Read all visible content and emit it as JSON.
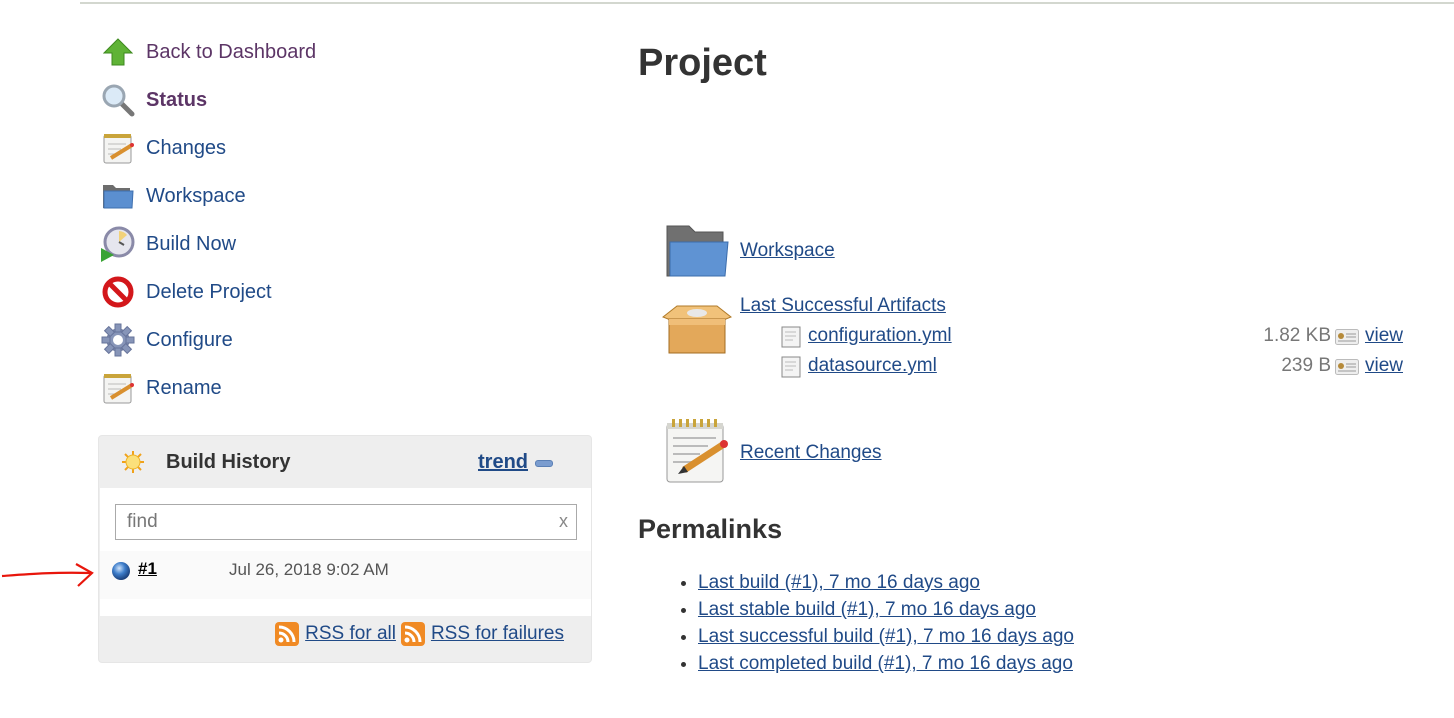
{
  "sidebar": {
    "tasks": [
      {
        "label": "Back to Dashboard",
        "icon": "up-arrow-icon",
        "state": "visited"
      },
      {
        "label": "Status",
        "icon": "magnifier-icon",
        "state": "active"
      },
      {
        "label": "Changes",
        "icon": "notepad-icon",
        "state": "normal"
      },
      {
        "label": "Workspace",
        "icon": "folder-icon",
        "state": "normal"
      },
      {
        "label": "Build Now",
        "icon": "clock-play-icon",
        "state": "normal"
      },
      {
        "label": "Delete Project",
        "icon": "no-entry-icon",
        "state": "normal"
      },
      {
        "label": "Configure",
        "icon": "gear-icon",
        "state": "normal"
      },
      {
        "label": "Rename",
        "icon": "notepad-icon",
        "state": "normal"
      }
    ]
  },
  "build_history": {
    "title": "Build History",
    "trend_label": "trend",
    "find": {
      "placeholder": "find",
      "value": "",
      "clear_label": "x"
    },
    "builds": [
      {
        "number": "#1",
        "timestamp": "Jul 26, 2018 9:02 AM",
        "status_color": "#3d7dca"
      }
    ],
    "rss_all": "RSS for all",
    "rss_failures": "RSS for failures"
  },
  "main": {
    "title": "Project",
    "workspace_link": "Workspace",
    "artifacts": {
      "title": "Last Successful Artifacts",
      "files": [
        {
          "name": "configuration.yml",
          "size": "1.82 KB",
          "view_label": "view"
        },
        {
          "name": "datasource.yml",
          "size": "239 B",
          "view_label": "view"
        }
      ]
    },
    "recent_changes_link": "Recent Changes",
    "permalinks": {
      "title": "Permalinks",
      "items": [
        "Last build (#1), 7 mo 16 days ago",
        "Last stable build (#1), 7 mo 16 days ago",
        "Last successful build (#1), 7 mo 16 days ago",
        "Last completed build (#1), 7 mo 16 days ago"
      ]
    }
  },
  "annotation": {
    "arrow_color": "#e8160c"
  },
  "colors": {
    "link": "#204a87",
    "visited": "#5c3566",
    "panel_bg": "#eeeeee"
  }
}
